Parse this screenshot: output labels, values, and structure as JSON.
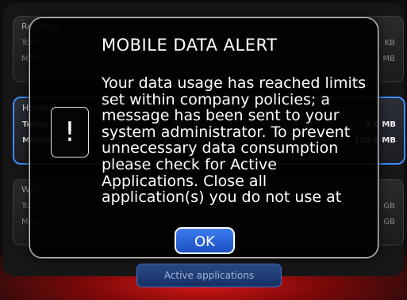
{
  "background_cards": [
    {
      "title": "Roaming",
      "rows": [
        {
          "label": "Today",
          "value": "KB"
        },
        {
          "label": "Month",
          "value": "MB"
        }
      ]
    },
    {
      "title": "Home",
      "rows": [
        {
          "label": "Today",
          "value": "5.0 MB"
        },
        {
          "label": "Month",
          "value": "100.0 MB"
        }
      ]
    },
    {
      "title": "WiFi",
      "rows": [
        {
          "label": "Today",
          "value": "GB"
        },
        {
          "label": "Month",
          "value": "GB"
        }
      ]
    }
  ],
  "background_button": {
    "label": "Active applications"
  },
  "dialog": {
    "title": "MOBILE DATA ALERT",
    "icon": "exclamation-icon",
    "icon_glyph": "!",
    "message": "Your data usage has reached limits set within company policies; a message has been sent to your system administrator. To prevent unnecessary data consumption please check for Active Applications. Close all application(s) you do not use at",
    "ok_label": "OK"
  },
  "colors": {
    "accent_blue": "#3d8cff",
    "alert_red": "#d41616"
  }
}
